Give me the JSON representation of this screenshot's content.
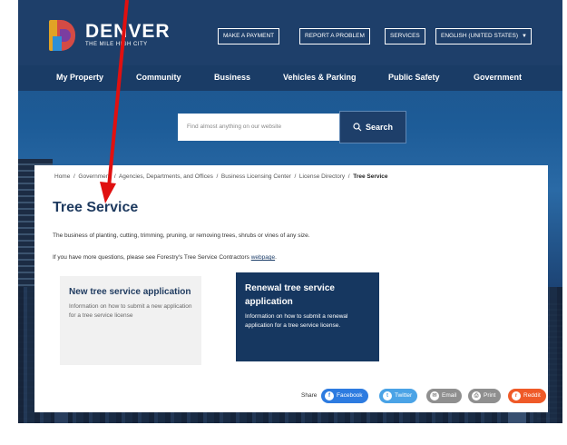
{
  "logo": {
    "name": "DENVER",
    "tagline": "THE MILE HIGH CITY"
  },
  "utility": {
    "make_payment": "MAKE A PAYMENT",
    "report_problem": "REPORT A PROBLEM",
    "services": "SERVICES",
    "language": "ENGLISH (UNITED STATES)"
  },
  "nav": [
    "My Property",
    "Community",
    "Business",
    "Vehicles & Parking",
    "Public Safety",
    "Government"
  ],
  "search": {
    "placeholder": "Find almost anything on our website",
    "button": "Search"
  },
  "breadcrumb": {
    "items": [
      "Home",
      "Government",
      "Agencies, Departments, and Offices",
      "Business Licensing Center",
      "License Directory"
    ],
    "current": "Tree Service",
    "separator": "/"
  },
  "page": {
    "title": "Tree Service",
    "description": "The business of planting, cutting, trimming, pruning, or removing trees, shrubs or vines of any size.",
    "more_text": "If you have more questions, please see Forestry's Tree Service Contractors",
    "more_link": "webpage",
    "more_end": "."
  },
  "tiles": {
    "new": {
      "title": "New tree service application",
      "text": "Information on how to submit a new application for a tree service license"
    },
    "renew": {
      "title": "Renewal tree service application",
      "text": "Information on how to submit a renewal application for a tree service license."
    }
  },
  "share": {
    "label": "Share",
    "facebook": "Facebook",
    "twitter": "Twitter",
    "email": "Email",
    "print": "Print",
    "reddit": "Reddit"
  },
  "colors": {
    "navy": "#1e3f6a",
    "title": "#1e3a5f",
    "facebook": "#2d7be0",
    "twitter": "#4aa3e6",
    "email": "#8f8f8f",
    "print": "#8f8f8f",
    "reddit": "#ef5a28",
    "annotation": "#e01010"
  }
}
